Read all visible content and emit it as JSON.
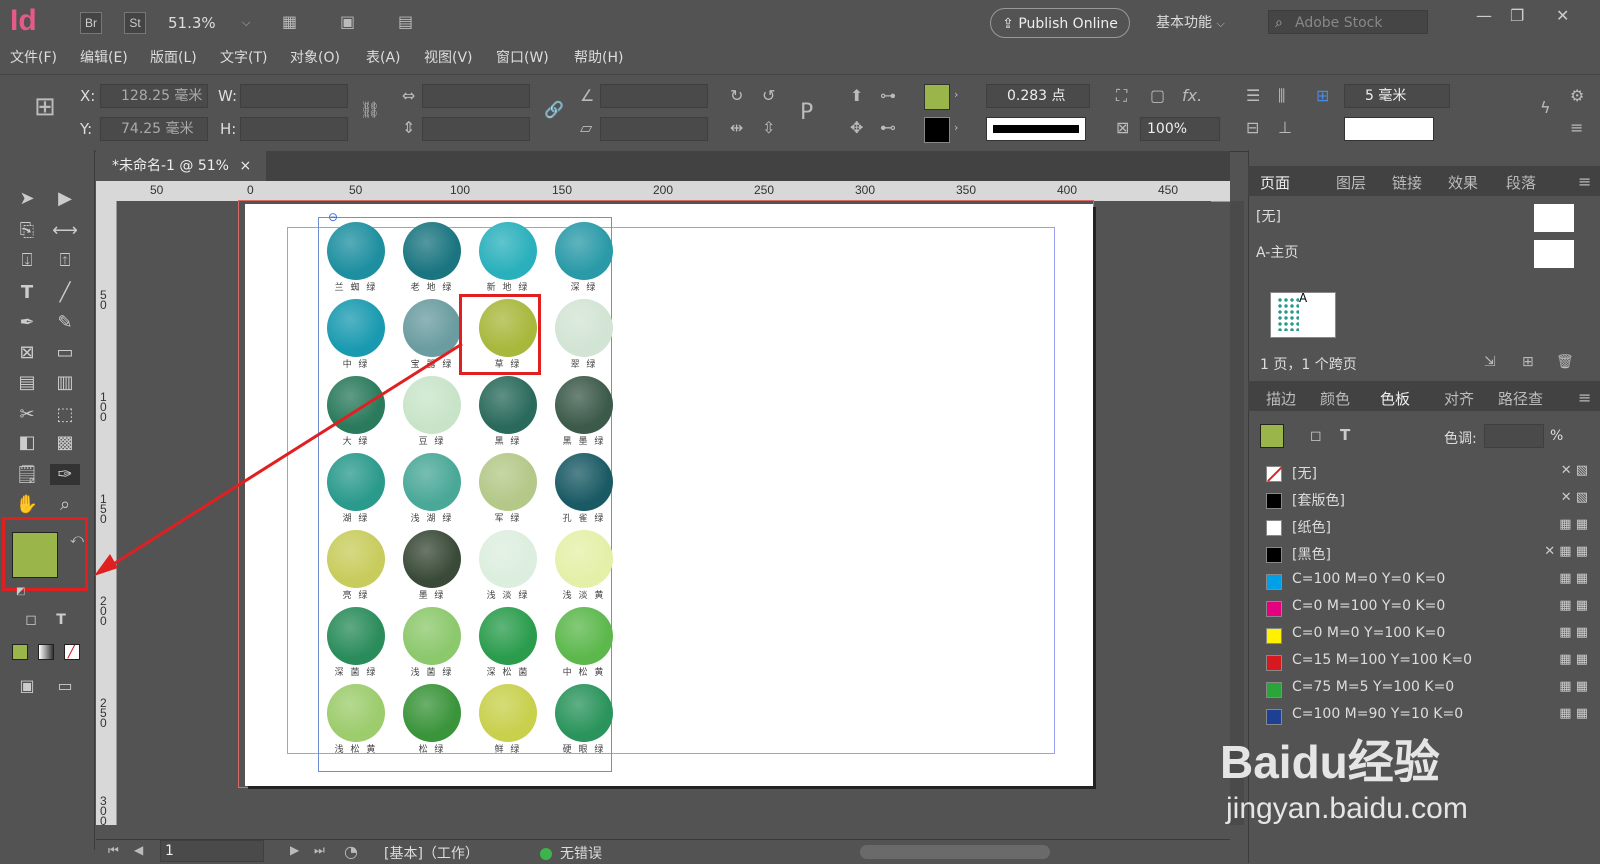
{
  "app": {
    "logo": "Id",
    "br": "Br",
    "st": "St",
    "zoom": "51.3%",
    "publish": "Publish Online",
    "workspace": "基本功能",
    "stock_placeholder": "Adobe Stock"
  },
  "menu": [
    "文件(F)",
    "编辑(E)",
    "版面(L)",
    "文字(T)",
    "对象(O)",
    "表(A)",
    "视图(V)",
    "窗口(W)",
    "帮助(H)"
  ],
  "control": {
    "x_label": "X:",
    "x_value": "128.25 毫米",
    "y_label": "Y:",
    "y_value": "74.25 毫米",
    "w_label": "W:",
    "h_label": "H:",
    "stroke_weight": "0.283 点",
    "scale": "100%",
    "gap": "5 毫米",
    "fill_color": "#9ab54a"
  },
  "document": {
    "tab_title": "*未命名-1 @ 51%",
    "close": "×"
  },
  "ruler": {
    "h_ticks": [
      "50",
      "0",
      "50",
      "100",
      "150",
      "200",
      "250",
      "300",
      "350",
      "400",
      "450"
    ],
    "v_ticks": [
      "5 0",
      "1 0 0",
      "1 5 0",
      "2 0 0",
      "2 5 0",
      "3 0 0"
    ]
  },
  "swatch_grid": [
    {
      "name": "兰 蜘 绿",
      "color": "#1e8fa0"
    },
    {
      "name": "老 地 绿",
      "color": "#1a7580"
    },
    {
      "name": "新 地 绿",
      "color": "#2ab0bc"
    },
    {
      "name": "深 绿",
      "color": "#2a9aa8"
    },
    {
      "name": "中 绿",
      "color": "#1a9ab0"
    },
    {
      "name": "宝 器 绿",
      "color": "#6a9ca0"
    },
    {
      "name": "草 绿",
      "color": "#a8b83c"
    },
    {
      "name": "翠 绿",
      "color": "#d2e4d4"
    },
    {
      "name": "大 绿",
      "color": "#2a7a5c"
    },
    {
      "name": "豆 绿",
      "color": "#c8e4c8"
    },
    {
      "name": "黑 绿",
      "color": "#2a6a5c"
    },
    {
      "name": "黑 墨 绿",
      "color": "#3c5a4a"
    },
    {
      "name": "湖 绿",
      "color": "#2a9a8c"
    },
    {
      "name": "浅 湖 绿",
      "color": "#4aa898"
    },
    {
      "name": "军 绿",
      "color": "#b4c888"
    },
    {
      "name": "孔 雀 绿",
      "color": "#1a5a64"
    },
    {
      "name": "亮 绿",
      "color": "#c8cc5c"
    },
    {
      "name": "墨 绿",
      "color": "#3a4a38"
    },
    {
      "name": "浅 淡 绿",
      "color": "#dceede"
    },
    {
      "name": "浅 淡 黄",
      "color": "#e4f0a8"
    },
    {
      "name": "深 菌 绿",
      "color": "#2a8c5a"
    },
    {
      "name": "浅 菌 绿",
      "color": "#8cc86c"
    },
    {
      "name": "深 松 菌",
      "color": "#2a9c4c"
    },
    {
      "name": "中 松 黄",
      "color": "#5cb84c"
    },
    {
      "name": "浅 松 黄",
      "color": "#9ccc6c"
    },
    {
      "name": "松 绿",
      "color": "#3a943a"
    },
    {
      "name": "鲜 绿",
      "color": "#c8d04c"
    },
    {
      "name": "硬 眼 绿",
      "color": "#2a945c"
    }
  ],
  "pages_panel": {
    "tabs": [
      "页面",
      "图层",
      "链接",
      "效果",
      "段落"
    ],
    "none": "[无]",
    "master": "A-主页",
    "thumb_label": "A",
    "summary": "1 页，1 个跨页"
  },
  "swatches_panel": {
    "tabs": [
      "描边",
      "颜色",
      "色板",
      "对齐",
      "路径查"
    ],
    "tint_label": "色调:",
    "tint_unit": "%",
    "items": [
      {
        "name": "[无]",
        "color": "#ffffff"
      },
      {
        "name": "[套版色]",
        "color": "#000000"
      },
      {
        "name": "[纸色]",
        "color": "#ffffff"
      },
      {
        "name": "[黑色]",
        "color": "#000000"
      },
      {
        "name": "C=100 M=0 Y=0 K=0",
        "color": "#00a0e9"
      },
      {
        "name": "C=0 M=100 Y=0 K=0",
        "color": "#e4007f"
      },
      {
        "name": "C=0 M=0 Y=100 K=0",
        "color": "#fff100"
      },
      {
        "name": "C=15 M=100 Y=100 K=0",
        "color": "#d7181f"
      },
      {
        "name": "C=75 M=5 Y=100 K=0",
        "color": "#2aa53a"
      },
      {
        "name": "C=100 M=90 Y=10 K=0",
        "color": "#1d3f94"
      }
    ]
  },
  "status": {
    "page": "1",
    "style": "[基本]（工作）",
    "errors": "无错误"
  },
  "watermark": {
    "brand": "Baidu经验",
    "url": "jingyan.baidu.com"
  }
}
